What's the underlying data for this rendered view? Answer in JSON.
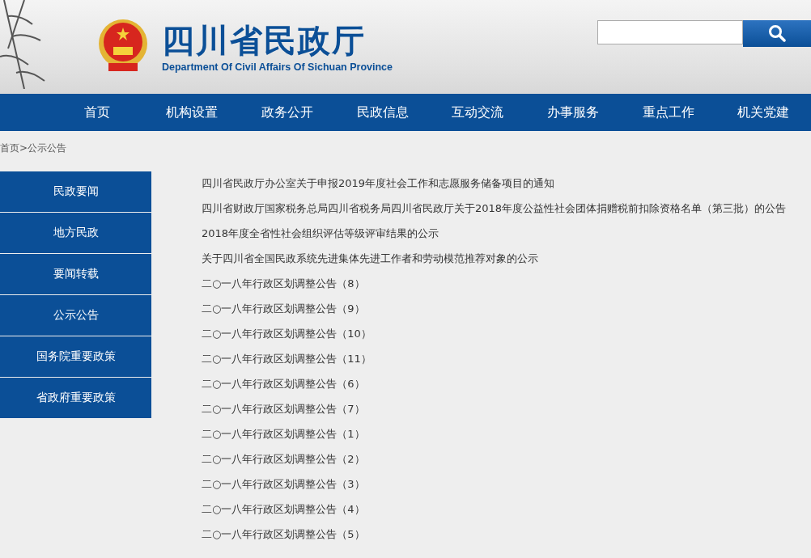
{
  "header": {
    "title": "四川省民政厅",
    "subtitle": "Department Of Civil Affairs Of Sichuan Province"
  },
  "nav": [
    "首页",
    "机构设置",
    "政务公开",
    "民政信息",
    "互动交流",
    "办事服务",
    "重点工作",
    "机关党建"
  ],
  "breadcrumb": {
    "items": [
      "首页",
      "公示公告"
    ],
    "separator": ">"
  },
  "sidebar": [
    "民政要闻",
    "地方民政",
    "要闻转载",
    "公示公告",
    "国务院重要政策",
    "省政府重要政策"
  ],
  "articles": [
    "四川省民政厅办公室关于申报2019年度社会工作和志愿服务储备项目的通知",
    "四川省财政厅国家税务总局四川省税务局四川省民政厅关于2018年度公益性社会团体捐赠税前扣除资格名单（第三批）的公告",
    "2018年度全省性社会组织评估等级评审结果的公示",
    "关于四川省全国民政系统先进集体先进工作者和劳动模范推荐对象的公示",
    "二○一八年行政区划调整公告（8）",
    "二○一八年行政区划调整公告（9）",
    "二○一八年行政区划调整公告（10）",
    "二○一八年行政区划调整公告（11）",
    "二○一八年行政区划调整公告（6）",
    "二○一八年行政区划调整公告（7）",
    "二○一八年行政区划调整公告（1）",
    "二○一八年行政区划调整公告（2）",
    "二○一八年行政区划调整公告（3）",
    "二○一八年行政区划调整公告（4）",
    "二○一八年行政区划调整公告（5）"
  ]
}
